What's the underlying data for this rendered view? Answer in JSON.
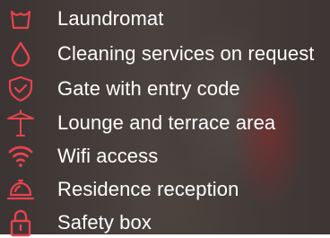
{
  "theme": {
    "icon_color": "#e8424f",
    "text_color": "#ffffff"
  },
  "amenities": [
    {
      "icon": "laundry-basket-icon",
      "label": "Laundromat"
    },
    {
      "icon": "water-drop-icon",
      "label": "Cleaning services on request"
    },
    {
      "icon": "shield-check-icon",
      "label": "Gate with entry code"
    },
    {
      "icon": "parasol-icon",
      "label": "Lounge and terrace area"
    },
    {
      "icon": "wifi-icon",
      "label": "Wifi access"
    },
    {
      "icon": "reception-bell-icon",
      "label": "Residence reception"
    },
    {
      "icon": "padlock-icon",
      "label": "Safety box"
    }
  ]
}
